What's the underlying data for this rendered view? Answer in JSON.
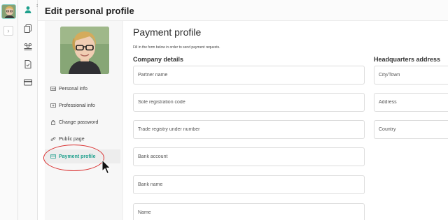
{
  "header": {
    "title": "Edit personal profile"
  },
  "nav": {
    "items": [
      {
        "label": "Personal info",
        "icon": "id-card-icon"
      },
      {
        "label": "Professional info",
        "icon": "briefcase-card-icon"
      },
      {
        "label": "Change password",
        "icon": "lock-icon"
      },
      {
        "label": "Public page",
        "icon": "link-icon"
      },
      {
        "label": "Payment profile",
        "icon": "credit-card-icon",
        "active": true
      }
    ]
  },
  "main": {
    "title": "Payment profile",
    "subtitle": "Fill in the form below in order to send payment requests.",
    "company_section": "Company details",
    "hq_section": "Headquarters address",
    "company_fields": [
      {
        "placeholder": "Partner name"
      },
      {
        "placeholder": "Sole registration code"
      },
      {
        "placeholder": "Trade registry under number"
      },
      {
        "placeholder": "Bank account"
      },
      {
        "placeholder": "Bank name"
      },
      {
        "placeholder": "Name"
      }
    ],
    "hq_fields": [
      {
        "placeholder": "City/Town"
      },
      {
        "placeholder": "Address"
      },
      {
        "placeholder": "Country"
      }
    ]
  },
  "colors": {
    "accent": "#1fa08d",
    "annotation": "#d92c2c"
  }
}
